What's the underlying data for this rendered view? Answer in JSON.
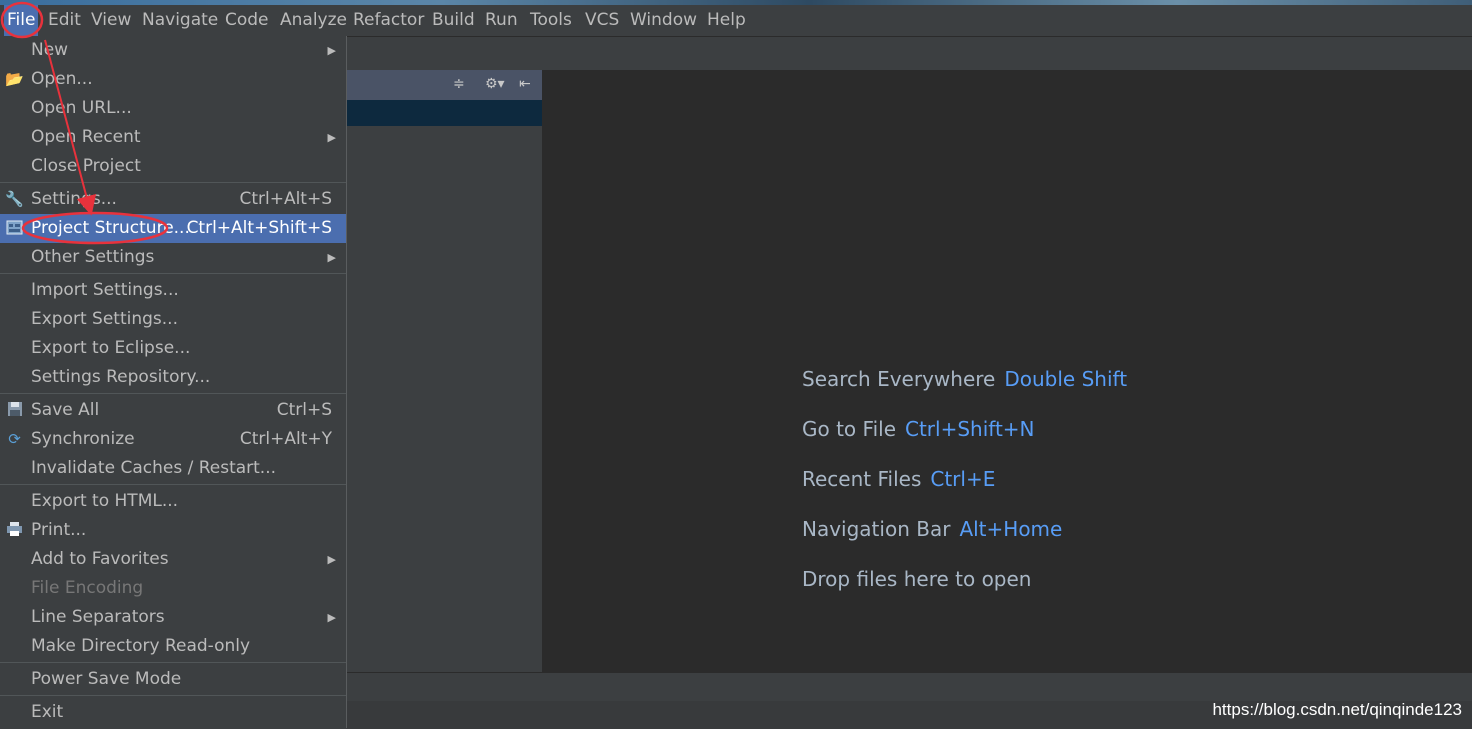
{
  "menubar": {
    "items": [
      {
        "label": "File",
        "active": true
      },
      {
        "label": "Edit"
      },
      {
        "label": "View"
      },
      {
        "label": "Navigate"
      },
      {
        "label": "Code"
      },
      {
        "label": "Analyze"
      },
      {
        "label": "Refactor"
      },
      {
        "label": "Build"
      },
      {
        "label": "Run"
      },
      {
        "label": "Tools"
      },
      {
        "label": "VCS"
      },
      {
        "label": "Window"
      },
      {
        "label": "Help"
      }
    ]
  },
  "file_menu": {
    "items": [
      {
        "label": "New",
        "submenu": true
      },
      {
        "label": "Open...",
        "icon": "folder-open-icon"
      },
      {
        "label": "Open URL..."
      },
      {
        "label": "Open Recent",
        "submenu": true
      },
      {
        "label": "Close Project"
      },
      {
        "label": "Settings...",
        "shortcut": "Ctrl+Alt+S",
        "icon": "wrench-icon"
      },
      {
        "label": "Project Structure...",
        "shortcut": "Ctrl+Alt+Shift+S",
        "icon": "project-structure-icon",
        "selected": true
      },
      {
        "label": "Other Settings",
        "submenu": true
      },
      {
        "label": "Import Settings..."
      },
      {
        "label": "Export Settings..."
      },
      {
        "label": "Export to Eclipse..."
      },
      {
        "label": "Settings Repository..."
      },
      {
        "label": "Save All",
        "shortcut": "Ctrl+S",
        "icon": "save-icon"
      },
      {
        "label": "Synchronize",
        "shortcut": "Ctrl+Alt+Y",
        "icon": "sync-icon"
      },
      {
        "label": "Invalidate Caches / Restart..."
      },
      {
        "label": "Export to HTML..."
      },
      {
        "label": "Print...",
        "icon": "printer-icon"
      },
      {
        "label": "Add to Favorites",
        "submenu": true
      },
      {
        "label": "File Encoding",
        "disabled": true
      },
      {
        "label": "Line Separators",
        "submenu": true
      },
      {
        "label": "Make Directory Read-only"
      },
      {
        "label": "Power Save Mode"
      },
      {
        "label": "Exit"
      }
    ]
  },
  "editor": {
    "hints": [
      {
        "text": "Search Everywhere",
        "key": "Double Shift"
      },
      {
        "text": "Go to File",
        "key": "Ctrl+Shift+N"
      },
      {
        "text": "Recent Files",
        "key": "Ctrl+E"
      },
      {
        "text": "Navigation Bar",
        "key": "Alt+Home"
      },
      {
        "text": "Drop files here to open",
        "key": ""
      }
    ]
  },
  "watermark": "https://blog.csdn.net/qinqinde123",
  "colors": {
    "menu_bg": "#3c3f41",
    "selection": "#4b6eaf",
    "editor_bg": "#2b2b2b",
    "hint_key": "#589df6",
    "annotation_red": "#e8323c"
  }
}
